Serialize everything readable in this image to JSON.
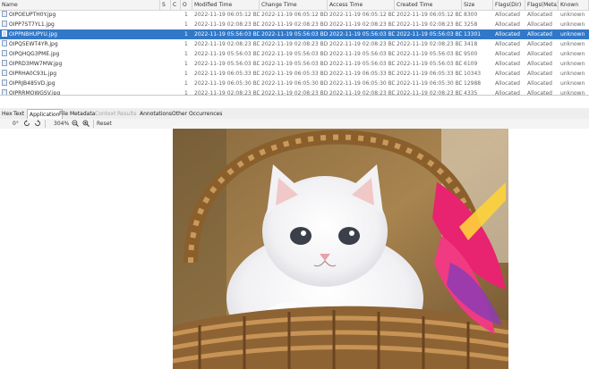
{
  "columns": [
    "Name",
    "S",
    "C",
    "O",
    "Modified Time",
    "Change Time",
    "Access Time",
    "Created Time",
    "Size",
    "Flags(Dir)",
    "Flags(Meta)",
    "Known"
  ],
  "rows": [
    {
      "name": "OIPOEUPTH0Y.jpg",
      "o": "1",
      "modified": "2022-11-19 06:05:12 BDT",
      "changed": "2022-11-19 06:05:12 BDT",
      "accessed": "2022-11-19 06:05:12 BDT",
      "created": "2022-11-19 06:05:12 BDT",
      "size": "8300",
      "flags_dir": "Allocated",
      "flags_meta": "Allocated",
      "known": "unknown",
      "selected": false
    },
    {
      "name": "OIPP7ST7YL1.jpg",
      "o": "1",
      "modified": "2022-11-19 02:08:23 BDT",
      "changed": "2022-11-19 02:08:23 BDT",
      "accessed": "2022-11-19 02:08:23 BDT",
      "created": "2022-11-19 02:08:23 BDT",
      "size": "3258",
      "flags_dir": "Allocated",
      "flags_meta": "Allocated",
      "known": "unknown",
      "selected": false
    },
    {
      "name": "OIPPNBHUPYU.jpg",
      "o": "1",
      "modified": "2022-11-19 05:56:03 BDT",
      "changed": "2022-11-19 05:56:03 BDT",
      "accessed": "2022-11-19 05:56:03 BDT",
      "created": "2022-11-19 05:56:03 BDT",
      "size": "13301",
      "flags_dir": "Allocated",
      "flags_meta": "Allocated",
      "known": "unknown",
      "selected": true
    },
    {
      "name": "OIPQ5EWT4YR.jpg",
      "o": "1",
      "modified": "2022-11-19 02:08:23 BDT",
      "changed": "2022-11-19 02:08:23 BDT",
      "accessed": "2022-11-19 02:08:23 BDT",
      "created": "2022-11-19 02:08:23 BDT",
      "size": "3418",
      "flags_dir": "Allocated",
      "flags_meta": "Allocated",
      "known": "unknown",
      "selected": false
    },
    {
      "name": "OIPQHQG3PME.jpg",
      "o": "1",
      "modified": "2022-11-19 05:56:03 BDT",
      "changed": "2022-11-19 05:56:03 BDT",
      "accessed": "2022-11-19 05:56:03 BDT",
      "created": "2022-11-19 05:56:03 BDT",
      "size": "9500",
      "flags_dir": "Allocated",
      "flags_meta": "Allocated",
      "known": "unknown",
      "selected": false
    },
    {
      "name": "OIPRD3MW7MW.jpg",
      "o": "1",
      "modified": "2022-11-19 05:56:03 BDT",
      "changed": "2022-11-19 05:56:03 BDT",
      "accessed": "2022-11-19 05:56:03 BDT",
      "created": "2022-11-19 05:56:03 BDT",
      "size": "6109",
      "flags_dir": "Allocated",
      "flags_meta": "Allocated",
      "known": "unknown",
      "selected": false
    },
    {
      "name": "OIPRHA0C93L.jpg",
      "o": "1",
      "modified": "2022-11-19 06:05:33 BDT",
      "changed": "2022-11-19 06:05:33 BDT",
      "accessed": "2022-11-19 06:05:33 BDT",
      "created": "2022-11-19 06:05:33 BDT",
      "size": "10343",
      "flags_dir": "Allocated",
      "flags_meta": "Allocated",
      "known": "unknown",
      "selected": false
    },
    {
      "name": "OIPRJB485VD.jpg",
      "o": "1",
      "modified": "2022-11-19 06:05:30 BDT",
      "changed": "2022-11-19 06:05:30 BDT",
      "accessed": "2022-11-19 06:05:30 BDT",
      "created": "2022-11-19 06:05:30 BDT",
      "size": "12988",
      "flags_dir": "Allocated",
      "flags_meta": "Allocated",
      "known": "unknown",
      "selected": false
    },
    {
      "name": "OIPRRMOWGSV.jpg",
      "o": "1",
      "modified": "2022-11-19 02:08:23 BDT",
      "changed": "2022-11-19 02:08:23 BDT",
      "accessed": "2022-11-19 02:08:23 BDT",
      "created": "2022-11-19 02:08:23 BDT",
      "size": "4335",
      "flags_dir": "Allocated",
      "flags_meta": "Allocated",
      "known": "unknown",
      "selected": false
    }
  ],
  "tabs": [
    {
      "label": "Hex",
      "active": false,
      "disabled": false
    },
    {
      "label": "Text",
      "active": false,
      "disabled": false
    },
    {
      "label": "Application",
      "active": true,
      "disabled": false
    },
    {
      "label": "File Metadata",
      "active": false,
      "disabled": false
    },
    {
      "label": "Context",
      "active": false,
      "disabled": true
    },
    {
      "label": "Results",
      "active": false,
      "disabled": true
    },
    {
      "label": "Annotations",
      "active": false,
      "disabled": false
    },
    {
      "label": "Other Occurrences",
      "active": false,
      "disabled": false
    }
  ],
  "toolbar": {
    "rotation": "0°",
    "zoom": "304%",
    "reset_label": "Reset",
    "rotate_left_icon": "rotate-left-icon",
    "rotate_right_icon": "rotate-right-icon",
    "zoom_out_icon": "zoom-out-icon",
    "zoom_in_icon": "zoom-in-icon"
  },
  "colors": {
    "selection": "#3278c8",
    "header_bg": "#f4f4f4",
    "tab_bg": "#eeeeee"
  }
}
